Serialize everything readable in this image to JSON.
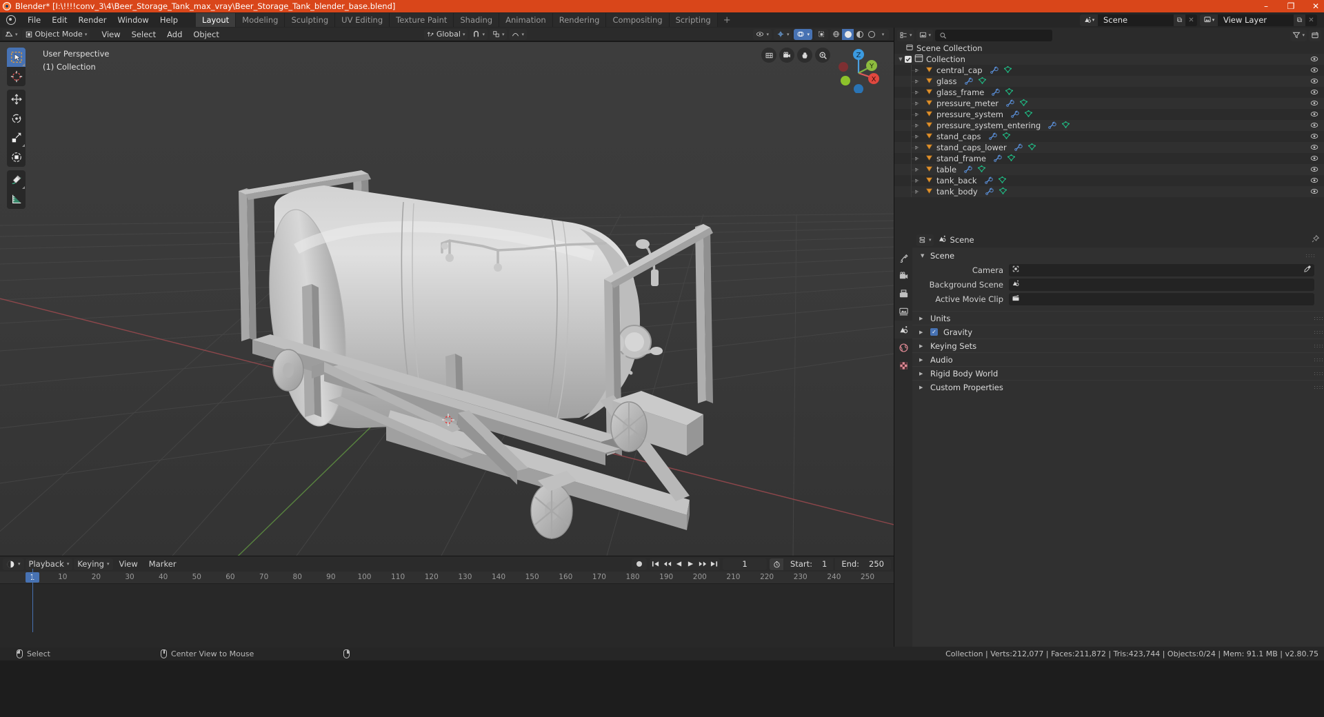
{
  "window": {
    "title": "Blender* [I:\\!!!!conv_3\\4\\Beer_Storage_Tank_max_vray\\Beer_Storage_Tank_blender_base.blend]",
    "minimize": "–",
    "maximize": "❐",
    "close": "✕"
  },
  "topbar": {
    "menus": [
      "File",
      "Edit",
      "Render",
      "Window",
      "Help"
    ],
    "workspaces": [
      {
        "label": "Layout",
        "active": true
      },
      {
        "label": "Modeling",
        "active": false
      },
      {
        "label": "Sculpting",
        "active": false
      },
      {
        "label": "UV Editing",
        "active": false
      },
      {
        "label": "Texture Paint",
        "active": false
      },
      {
        "label": "Shading",
        "active": false
      },
      {
        "label": "Animation",
        "active": false
      },
      {
        "label": "Rendering",
        "active": false
      },
      {
        "label": "Compositing",
        "active": false
      },
      {
        "label": "Scripting",
        "active": false
      }
    ],
    "add_workspace": "+",
    "scene_name": "Scene",
    "view_layer_name": "View Layer",
    "new_copy": "⧉",
    "unlink": "✕"
  },
  "viewport_header": {
    "editor_type": "editor-type-3dview",
    "mode": "Object Mode",
    "menus": [
      "View",
      "Select",
      "Add",
      "Object"
    ],
    "transform_orientation": "Global",
    "snap": "snap-magnet",
    "proportional": "proportional-editing",
    "visibility": "visibility-dropdown",
    "gizmo": "gizmo-toggle",
    "overlays": "overlays-toggle",
    "xray": "xray-toggle",
    "shading_modes": [
      "wireframe",
      "solid",
      "material-preview",
      "rendered"
    ],
    "shading_active": "solid"
  },
  "viewport": {
    "perspective": "User Perspective",
    "collection_info": "(1) Collection",
    "gizmo_axes": [
      "X",
      "Y",
      "Z"
    ],
    "nav_buttons": [
      "grid-ortho-toggle",
      "camera-view",
      "pan-view",
      "zoom-view"
    ],
    "tools": [
      {
        "name": "tweak-select-tool",
        "active": true
      },
      {
        "name": "cursor-tool",
        "active": false
      },
      {
        "name": "move-tool",
        "active": false
      },
      {
        "name": "rotate-tool",
        "active": false
      },
      {
        "name": "scale-tool",
        "active": false
      },
      {
        "name": "transform-tool",
        "active": false
      },
      {
        "name": "annotate-tool",
        "active": false
      },
      {
        "name": "measure-tool",
        "active": false
      }
    ]
  },
  "outliner": {
    "display_mode": "view-layer",
    "filter_icon": "filter-funnel",
    "new_collection_icon": "new-collection",
    "search_placeholder": "",
    "scene_collection": "Scene Collection",
    "collection": "Collection",
    "objects": [
      "central_cap",
      "glass",
      "glass_frame",
      "pressure_meter",
      "pressure_system",
      "pressure_system_entering",
      "stand_caps",
      "stand_caps_lower",
      "stand_frame",
      "table",
      "tank_back",
      "tank_body"
    ]
  },
  "properties": {
    "tabs": [
      "tool",
      "render",
      "output",
      "view-layer",
      "scene",
      "world",
      "texture"
    ],
    "active_tab": "scene",
    "breadcrumb": "Scene",
    "panel_title": "Scene",
    "rows": [
      {
        "label": "Camera",
        "value": "",
        "icon": "camera-data-icon",
        "has_eyedropper": true
      },
      {
        "label": "Background Scene",
        "value": "",
        "icon": "scene-icon",
        "has_eyedropper": false
      },
      {
        "label": "Active Movie Clip",
        "value": "",
        "icon": "movie-clip-icon",
        "has_eyedropper": false
      }
    ],
    "sub_panels": [
      {
        "label": "Units",
        "checkbox": null
      },
      {
        "label": "Gravity",
        "checkbox": true
      },
      {
        "label": "Keying Sets",
        "checkbox": null
      },
      {
        "label": "Audio",
        "checkbox": null
      },
      {
        "label": "Rigid Body World",
        "checkbox": null
      },
      {
        "label": "Custom Properties",
        "checkbox": null
      }
    ]
  },
  "timeline": {
    "editor_icon": "timeline-editor-icon",
    "menus": [
      "Playback",
      "Keying",
      "View",
      "Marker"
    ],
    "record_icon": "auto-keying-record",
    "playback_buttons": [
      "jump-to-start",
      "jump-prev-keyframe",
      "play-reverse",
      "play",
      "jump-next-keyframe",
      "jump-to-end"
    ],
    "current_frame": "1",
    "frame_icon": "frame-range-clock",
    "start_label": "Start:",
    "start_value": "1",
    "end_label": "End:",
    "end_value": "250",
    "ticks": [
      10,
      20,
      30,
      40,
      50,
      60,
      70,
      80,
      90,
      100,
      110,
      120,
      130,
      140,
      150,
      160,
      170,
      180,
      190,
      200,
      210,
      220,
      230,
      240,
      250
    ],
    "playhead_label": "1"
  },
  "statusbar": {
    "left_items": [
      {
        "icon": "mouse-left-icon",
        "label": "Select"
      },
      {
        "icon": "mouse-middle-icon",
        "label": "Center View to Mouse"
      },
      {
        "icon": "mouse-right-icon",
        "label": ""
      }
    ],
    "stats": "Collection | Verts:212,077 | Faces:211,872 | Tris:423,744 | Objects:0/24 | Mem: 91.1 MB | v2.80.75"
  },
  "colors": {
    "title_bar": "#d9461a",
    "accent_blue": "#4772b3",
    "object_orange": "#e2922d",
    "mesh_green": "#1fc48a",
    "modifier_blue": "#5a8fd8"
  }
}
